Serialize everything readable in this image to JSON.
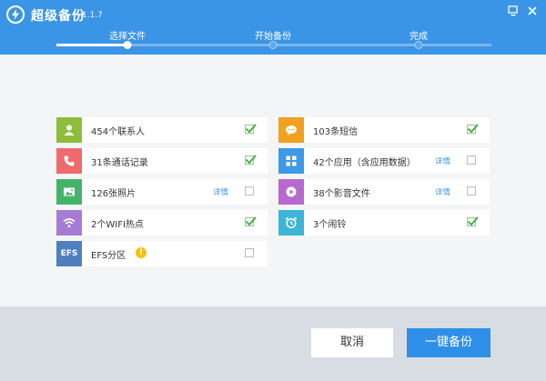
{
  "app": {
    "title": "超级备份",
    "version": "1.1.7"
  },
  "steps": [
    {
      "label": "选择文件",
      "state": "active"
    },
    {
      "label": "开始备份",
      "state": "pending"
    },
    {
      "label": "完成",
      "state": "pending"
    }
  ],
  "items": [
    {
      "label": "454个联系人",
      "icon": "contact-icon",
      "color": "#8dbd3a",
      "detail": "",
      "checked": true
    },
    {
      "label": "103条短信",
      "icon": "sms-icon",
      "color": "#f2a020",
      "detail": "",
      "checked": true
    },
    {
      "label": "31条通话记录",
      "icon": "phone-icon",
      "color": "#ef6a6a",
      "detail": "",
      "checked": true
    },
    {
      "label": "42个应用（含应用数据）",
      "icon": "apps-icon",
      "color": "#3d9ae6",
      "detail": "详情",
      "checked": false
    },
    {
      "label": "126张照片",
      "icon": "photo-icon",
      "color": "#43b36a",
      "detail": "详情",
      "checked": false
    },
    {
      "label": "38个影音文件",
      "icon": "media-icon",
      "color": "#b769d0",
      "detail": "详情",
      "checked": false
    },
    {
      "label": "2个WIFI热点",
      "icon": "wifi-icon",
      "color": "#a57bd6",
      "detail": "",
      "checked": true
    },
    {
      "label": "3个闹铃",
      "icon": "alarm-icon",
      "color": "#3cb5d6",
      "detail": "",
      "checked": true
    },
    {
      "label": "EFS分区",
      "icon": "efs-icon",
      "icon_text": "EFS",
      "color": "#4f7fbf",
      "detail": "",
      "checked": false,
      "warning": "!"
    }
  ],
  "buttons": {
    "cancel": "取消",
    "backup": "一键备份"
  },
  "colors": {
    "header": "#3b95e6",
    "primary": "#2f8fe8",
    "check": "#3cae3c"
  }
}
